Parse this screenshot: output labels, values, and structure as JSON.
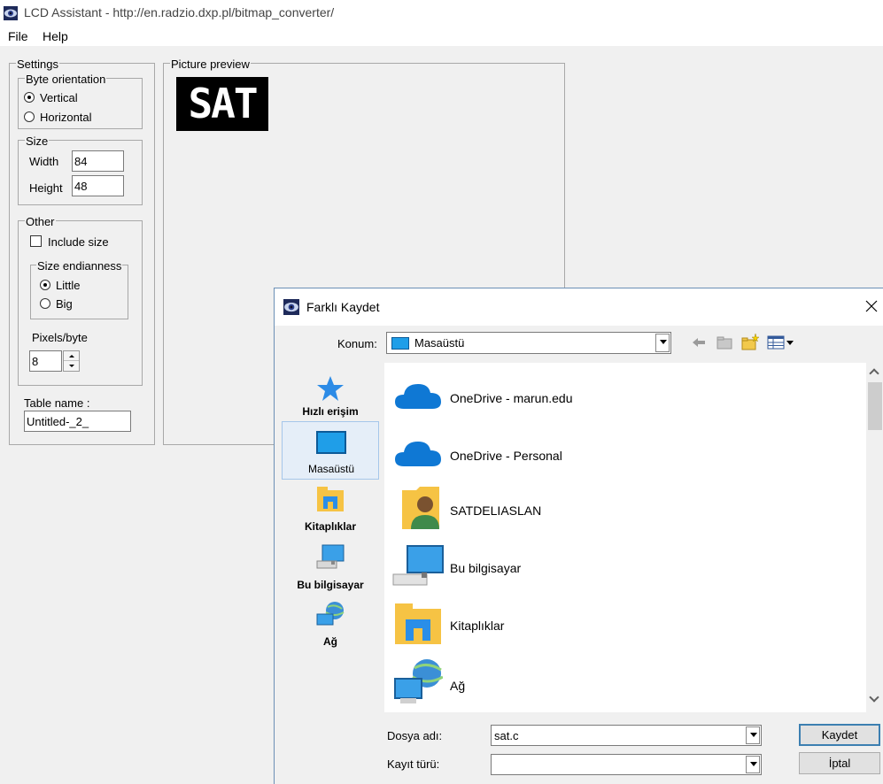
{
  "app": {
    "title": "LCD Assistant -  http://en.radzio.dxp.pl/bitmap_converter/",
    "menu": [
      "File",
      "Help"
    ]
  },
  "settings": {
    "group_label": "Settings",
    "byte_orientation": {
      "label": "Byte orientation",
      "options": [
        "Vertical",
        "Horizontal"
      ],
      "selected": "Vertical"
    },
    "size": {
      "label": "Size",
      "width_label": "Width",
      "width_value": "84",
      "height_label": "Height",
      "height_value": "48"
    },
    "other": {
      "label": "Other",
      "include_size_label": "Include size",
      "include_size_checked": false,
      "endianness": {
        "label": "Size endianness",
        "options": [
          "Little",
          "Big"
        ],
        "selected": "Little"
      },
      "pixels_label": "Pixels/byte",
      "pixels_value": "8"
    },
    "table_name_label": "Table name :",
    "table_name_value": "Untitled-_2_"
  },
  "preview": {
    "label": "Picture preview",
    "image_text": "SAT"
  },
  "dialog": {
    "title": "Farklı Kaydet",
    "location_label": "Konum:",
    "location_value": "Masaüstü",
    "places": [
      "Hızlı erişim",
      "Masaüstü",
      "Kitaplıklar",
      "Bu bilgisayar",
      "Ağ"
    ],
    "files": [
      {
        "name": "OneDrive - marun.edu",
        "icon": "onedrive-cloud-icon"
      },
      {
        "name": "OneDrive - Personal",
        "icon": "onedrive-cloud-icon"
      },
      {
        "name": "SATDELIASLAN",
        "icon": "user-folder-icon"
      },
      {
        "name": "Bu bilgisayar",
        "icon": "computer-icon"
      },
      {
        "name": "Kitaplıklar",
        "icon": "libraries-icon"
      },
      {
        "name": "Ağ",
        "icon": "network-icon"
      }
    ],
    "filename_label": "Dosya adı:",
    "filename_value": "sat.c",
    "filetype_label": "Kayıt türü:",
    "filetype_value": "",
    "save_button": "Kaydet",
    "cancel_button": "İptal"
  }
}
